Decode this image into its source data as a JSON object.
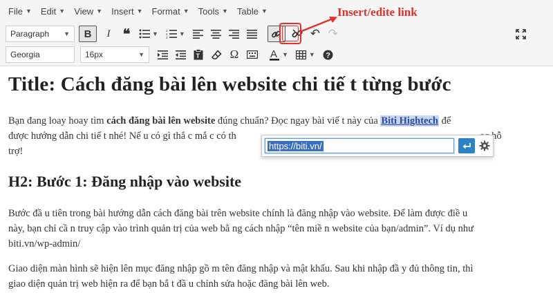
{
  "menu": [
    {
      "label": "File"
    },
    {
      "label": "Edit"
    },
    {
      "label": "View"
    },
    {
      "label": "Insert"
    },
    {
      "label": "Format"
    },
    {
      "label": "Tools"
    },
    {
      "label": "Table"
    }
  ],
  "toolbar": {
    "block_format": "Paragraph",
    "font_family": "Georgia",
    "font_size": "16px",
    "bold_pressed": true,
    "link_pressed": true
  },
  "annotation": {
    "text": "Insert/edite link",
    "color": "#e2312b"
  },
  "content": {
    "title": "Title: Cách đăng bài lên website chi tiế t từng bước",
    "p1_line1_a": "Bạn đang loay hoay tìm ",
    "p1_line1_bold": "cách đăng bài lên website",
    "p1_line1_b": " đúng chuẩn? Đọc ngay bài viế t này của ",
    "p1_link": "Biti Hightech",
    "p1_line1_c": " để",
    "p1_line2_a": "được hướng dẫn chi tiế t nhé! Nế u có gì thắ c mắ c có th",
    "p1_line2_b": "ọc hỗ",
    "p1_line3": "trợ!",
    "h2": "H2: Bước 1: Đăng nhập vào website",
    "p2_line1": "Bước đầ u tiên trong bài hướng dẫn cách đăng bài trên website chính là đăng nhập vào website. Để làm được điề u",
    "p2_line2": "này, bạn chỉ cầ n truy cập vào trình quản trị của web bằ ng cách nhập “tên miề n website của bạn/admin”. Ví dụ như",
    "p2_line3": "biti.vn/wp-admin/",
    "p3_line1": "Giao diện màn hình sẽ hiện lên mục đăng nhập gồ m tên đăng nhập và mật khẩu. Sau khi nhập đầ y đủ thông tin, thì",
    "p3_line2": "giao diện quản trị web hiện ra để bạn bắ t đầ u chỉnh sửa hoặc đăng bài lên web."
  },
  "link_popup": {
    "url": "https://biti.vn/"
  },
  "colors": {
    "accent_blue": "#2a82c4",
    "link_blue": "#2a4ba8",
    "highlight_red": "#e2312b"
  }
}
